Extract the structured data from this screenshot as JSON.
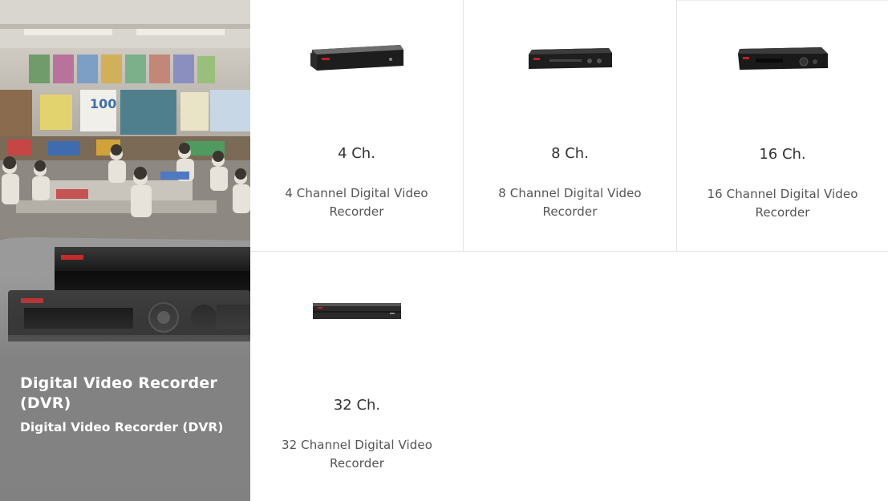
{
  "hero": {
    "title": "Digital Video Recorder (DVR)",
    "subtitle": "Digital Video Recorder (DVR)",
    "background_image": "classroom-with-dvr-device"
  },
  "products": [
    {
      "channels": "4 Ch.",
      "description": "4 Channel Digital Video Recorder",
      "image": "dvr-4ch"
    },
    {
      "channels": "8 Ch.",
      "description": "8 Channel Digital Video Recorder",
      "image": "dvr-8ch"
    },
    {
      "channels": "16 Ch.",
      "description": "16 Channel Digital Video Recorder",
      "image": "dvr-16ch"
    },
    {
      "channels": "32 Ch.",
      "description": "32 Channel Digital Video Recorder",
      "image": "dvr-32ch"
    }
  ],
  "colors": {
    "hero_text": "#ffffff",
    "card_border": "#e3e3e3",
    "title_text": "#333333",
    "desc_text": "#555555"
  }
}
